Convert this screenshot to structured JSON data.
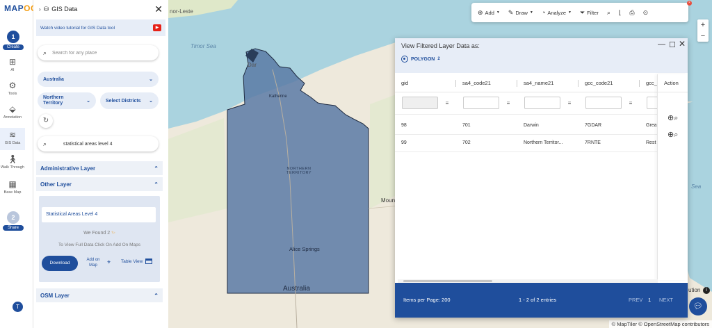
{
  "app": {
    "logo_main": "MAP",
    "logo_accent": "OG"
  },
  "rail": {
    "step1_number": "1",
    "step1_label": "Create",
    "items": [
      {
        "label": "AI"
      },
      {
        "label": "Tools"
      },
      {
        "label": "Annotation"
      },
      {
        "label": "GIS Data"
      },
      {
        "label": "Walk Through"
      },
      {
        "label": "Base Map"
      }
    ],
    "step2_number": "2",
    "step2_label": "Share",
    "avatar_initial": "T"
  },
  "panel": {
    "title": "GIS Data",
    "tutorial_text": "Watch video tutorial for GIS Data tool",
    "search_placeholder": "Search for any place",
    "country": "Australia",
    "state": "Northern Territory",
    "district": "Select Districts",
    "dataset_query": "statistical areas level 4",
    "sections": {
      "administrative": "Administrative Layer",
      "other": "Other Layer",
      "osm": "OSM Layer"
    },
    "layer": {
      "name": "Statistical Areas Level 4",
      "found_prefix": "We Found",
      "found_count": "2",
      "hint": "To View Full Data Click On Add On Maps",
      "download": "Download",
      "add_on_map": "Add on Map",
      "table_view": "Table View"
    }
  },
  "toolbar": {
    "add": "Add",
    "draw": "Draw",
    "analyze": "Analyze",
    "filter": "Filter"
  },
  "map_labels": {
    "timor_leste": "nor-Leste",
    "timor_sea": "Timor Sea",
    "darwin": "Dar",
    "katherine": "Katherine",
    "territory": "NORTHERN TERRITORY",
    "alice": "Alice Springs",
    "australia": "Australia",
    "mount": "Mount",
    "coral_sea": "Sea",
    "attribution_fragment": "ution",
    "attribution": "© MapTiler © OpenStreetMap contributors"
  },
  "dialog": {
    "title": "View Filtered Layer Data as:",
    "geometry": "POLYGON",
    "geometry_count": "2",
    "columns": [
      "gid",
      "sa4_code21",
      "sa4_name21",
      "gcc_code21",
      "gcc_"
    ],
    "action_header": "Action",
    "rows": [
      [
        "98",
        "701",
        "Darwin",
        "7GDAR",
        "Grea"
      ],
      [
        "99",
        "702",
        "Northern Territor...",
        "7RNTE",
        "Rest"
      ]
    ],
    "footer": {
      "items_per_page": "Items per Page: 200",
      "entries": "1 - 2 of 2 entries",
      "prev": "PREV",
      "page": "1",
      "next": "NEXT"
    }
  },
  "colors": {
    "brand": "#1f4e9c",
    "accent": "#f39c12",
    "polygon_fill": "#5b7aa6",
    "ocean": "#aad3df"
  }
}
